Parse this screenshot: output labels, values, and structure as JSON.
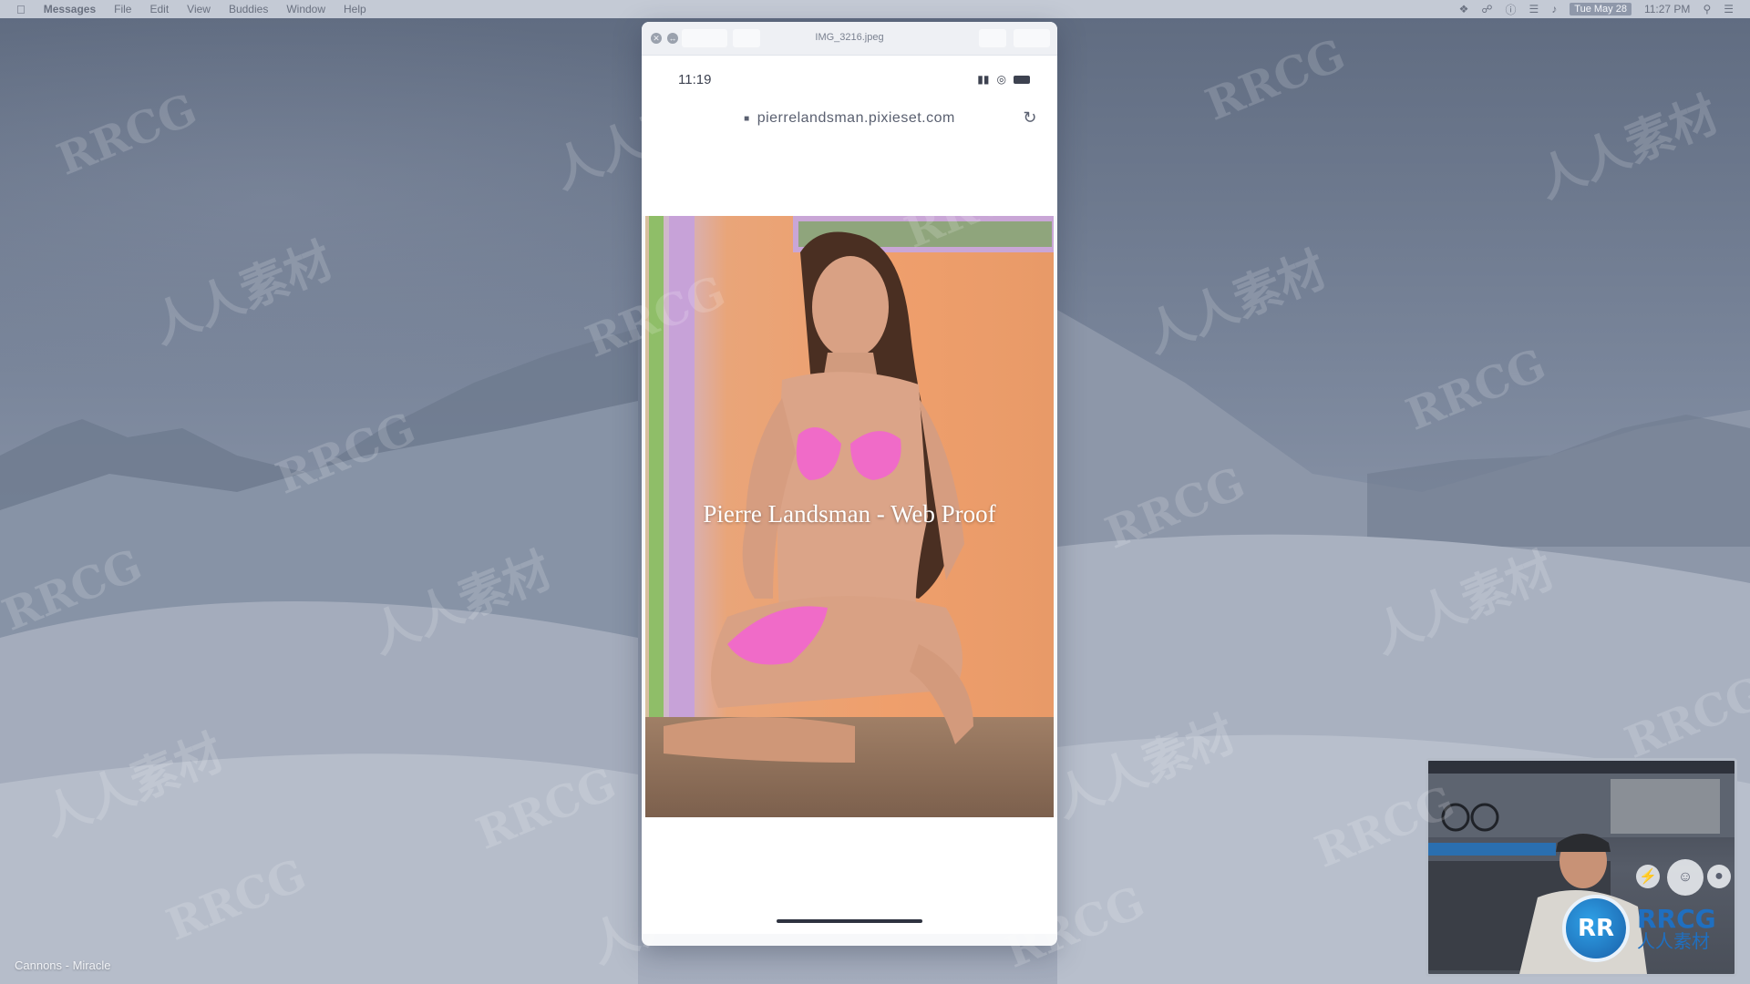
{
  "menubar": {
    "app_name": "Messages",
    "items": [
      "File",
      "Edit",
      "View",
      "Buddies",
      "Window",
      "Help"
    ],
    "date": "Tue May 28",
    "time": "11:27 PM"
  },
  "window": {
    "title": "IMG_3216.jpeg"
  },
  "phone": {
    "status_time": "11:19",
    "url": "pierrelandsman.pixieset.com",
    "hero_title": "Pierre Landsman - Web Proof"
  },
  "now_playing": "Cannons - Miracle",
  "watermark": {
    "latin": "RRCG",
    "cjk": "人人素材"
  },
  "logo": {
    "badge": "RR",
    "name": "RRCG",
    "subtitle": "人人素材"
  },
  "colors": {
    "hero_title": "#ffffff",
    "bikini": "#f06bc8",
    "logo_blue": "#1f6fc0"
  }
}
